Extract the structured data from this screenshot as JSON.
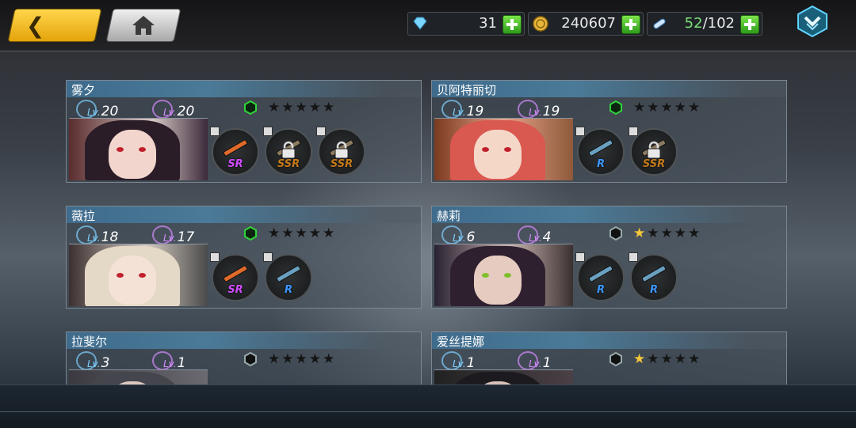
{
  "topbar": {
    "resources": [
      {
        "icon": "diamond-icon",
        "value": "31"
      },
      {
        "icon": "coin-icon",
        "value": "240607"
      },
      {
        "icon": "stamina-icon",
        "value_current": "52",
        "value_max": "/102"
      }
    ]
  },
  "characters": [
    {
      "name": "雾夕",
      "lv_blue": "20",
      "lv_purple": "20",
      "hex_color": "#2fd43a",
      "stars": 0,
      "equipment": [
        {
          "rank": "SR",
          "locked": false
        },
        {
          "rank": "SSR",
          "locked": true
        },
        {
          "rank": "SSR",
          "locked": true
        }
      ]
    },
    {
      "name": "贝阿特丽切",
      "lv_blue": "19",
      "lv_purple": "19",
      "hex_color": "#2fd43a",
      "stars": 0,
      "equipment": [
        {
          "rank": "R",
          "locked": false
        },
        {
          "rank": "SSR",
          "locked": true
        }
      ]
    },
    {
      "name": "薇拉",
      "lv_blue": "18",
      "lv_purple": "17",
      "hex_color": "#2fd43a",
      "stars": 0,
      "equipment": [
        {
          "rank": "SR",
          "locked": false
        },
        {
          "rank": "R",
          "locked": false
        }
      ]
    },
    {
      "name": "赫莉",
      "lv_blue": "6",
      "lv_purple": "4",
      "hex_color": "#1a1a1a",
      "stars": 1,
      "equipment": [
        {
          "rank": "R",
          "locked": false
        },
        {
          "rank": "R",
          "locked": false
        }
      ]
    },
    {
      "name": "拉斐尔",
      "lv_blue": "3",
      "lv_purple": "1",
      "hex_color": "#1a1a1a",
      "stars": 0,
      "equipment": []
    },
    {
      "name": "爱丝提娜",
      "lv_blue": "1",
      "lv_purple": "1",
      "hex_color": "#1a1a1a",
      "stars": 1,
      "equipment": []
    }
  ],
  "lv_prefix": "Lv.",
  "max_stars": 5,
  "colors": {
    "accent_gold": "#f5c63a",
    "plus_green": "#4cc52a",
    "sr": "#d04cff",
    "ssr": "#c47a1a",
    "r": "#3d96ff"
  }
}
